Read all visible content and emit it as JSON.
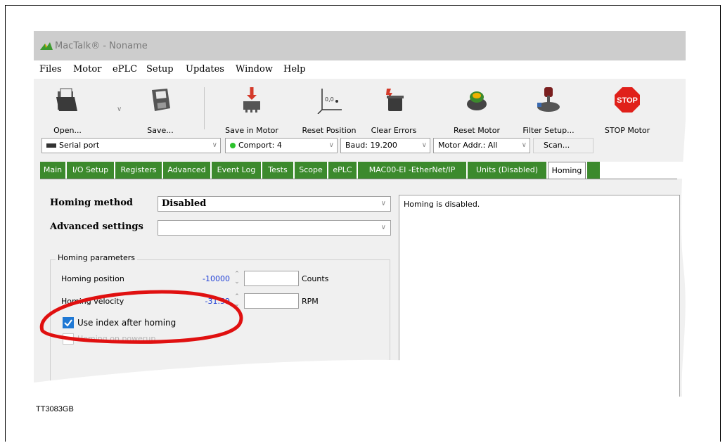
{
  "window": {
    "title": "MacTalk® - Noname"
  },
  "menu": [
    "Files",
    "Motor",
    "ePLC",
    "Setup",
    "Updates",
    "Window",
    "Help"
  ],
  "toolbar": {
    "open": "Open...",
    "save": "Save...",
    "save_in_motor": "Save in Motor",
    "reset_position": "Reset Position",
    "clear_errors": "Clear Errors",
    "reset_motor": "Reset Motor",
    "filter_setup": "Filter Setup...",
    "stop_motor": "STOP Motor",
    "stop_sign": "STOP"
  },
  "connection": {
    "port": "Serial port",
    "comport": "Comport: 4",
    "baud": "Baud: 19.200",
    "motor_addr": "Motor Addr.: All",
    "scan": "Scan..."
  },
  "tabs": [
    "Main",
    "I/O Setup",
    "Registers",
    "Advanced",
    "Event Log",
    "Tests",
    "Scope",
    "ePLC",
    "MAC00-EI -EtherNet/IP",
    "Units (Disabled)",
    "Homing"
  ],
  "active_tab": "Homing",
  "homing": {
    "method_label": "Homing method",
    "method_value": "Disabled",
    "advanced_label": "Advanced settings",
    "advanced_value": "",
    "description": "Homing is disabled.",
    "params_title": "Homing parameters",
    "position_label": "Homing position",
    "position_value": "-10000",
    "position_unit": "Counts",
    "velocity_label": "Homing velocity",
    "velocity_value": "-31.59",
    "velocity_unit": "RPM",
    "use_index_label": "Use index after homing",
    "use_index_checked": true,
    "on_powerup_label": "Homing on powerup",
    "on_powerup_checked": false
  },
  "colors": {
    "tab_green": "#3c8a2d",
    "value_blue": "#1f3fd6",
    "highlight_red": "#e01010",
    "checkbox_blue": "#1f78d4"
  },
  "footer": {
    "doc_id": "TT3083GB"
  }
}
